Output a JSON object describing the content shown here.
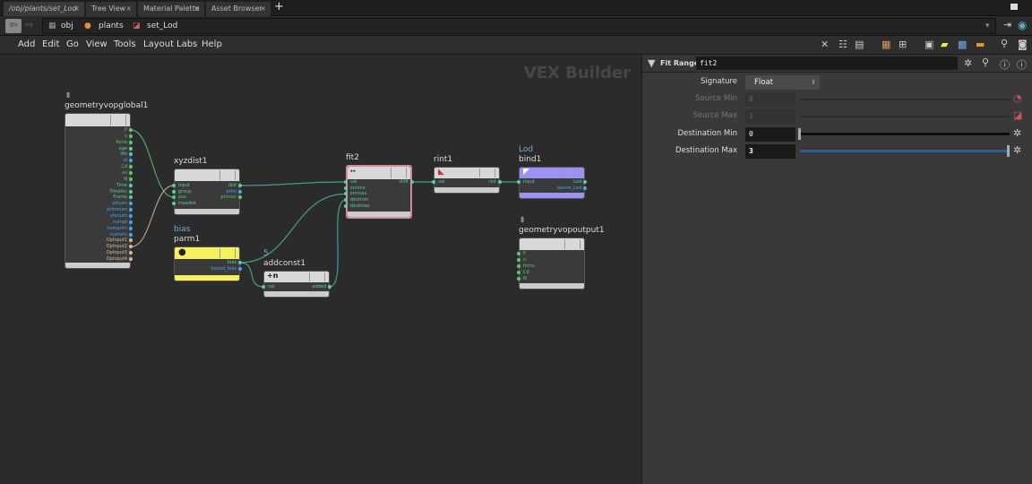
{
  "tabs": [
    {
      "label": "/obj/plants/set_Lod",
      "active": true
    },
    {
      "label": "Tree View"
    },
    {
      "label": "Material Palette"
    },
    {
      "label": "Asset Browser"
    }
  ],
  "tab_add": "+",
  "tab_close": "×",
  "breadcrumb": [
    "obj",
    "plants",
    "set_Lod"
  ],
  "menu": [
    "Add",
    "Edit",
    "Go",
    "View",
    "Tools",
    "Layout",
    "Labs",
    "Help"
  ],
  "graph_title": "VEX Builder",
  "nodes": {
    "global": {
      "name": "geometryvopglobal1",
      "outputs": [
        "P",
        "v",
        "force",
        "age",
        "life",
        "id",
        "Cd",
        "uv",
        "N",
        "Time",
        "TimeInc",
        "Frame",
        "ptnum",
        "primnum",
        "vtxnum",
        "numpt",
        "numprim",
        "numvtx",
        "OpInput1",
        "OpInput2",
        "OpInput3",
        "OpInput4"
      ]
    },
    "xyzdist": {
      "name": "xyzdist1",
      "inputs": [
        "input",
        "group",
        "pos",
        "maxdist"
      ],
      "outputs": [
        "dist",
        "prim",
        "primuv"
      ]
    },
    "parm": {
      "name": "parm1",
      "sub": "bias",
      "outputs": [
        "bias",
        "bound_bias"
      ]
    },
    "addconst": {
      "name": "addconst1",
      "sub": "5",
      "icon": "+n",
      "inputs": [
        "val"
      ],
      "outputs": [
        "added"
      ]
    },
    "fit": {
      "name": "fit2",
      "inputs": [
        "val",
        "srcmin",
        "srcmax",
        "destmin",
        "destmax"
      ],
      "outputs": [
        "shift"
      ]
    },
    "rint": {
      "name": "rint1",
      "inputs": [
        "val"
      ],
      "outputs": [
        "rint"
      ]
    },
    "bind": {
      "name": "bind1",
      "sub": "Lod",
      "inputs": [
        "input"
      ],
      "outputs": [
        "Lod",
        "bound_Lod"
      ]
    },
    "output": {
      "name": "geometryvopoutput1",
      "inputs": [
        "P",
        "v",
        "force",
        "Cd",
        "N"
      ]
    }
  },
  "params": {
    "node_type": "Fit Range",
    "node_name": "fit2",
    "signature": {
      "label": "Signature",
      "value": "Float"
    },
    "source_min": {
      "label": "Source Min",
      "value": "0"
    },
    "source_max": {
      "label": "Source Max",
      "value": "1"
    },
    "dest_min": {
      "label": "Destination Min",
      "value": "0",
      "fraction": 0
    },
    "dest_max": {
      "label": "Destination Max",
      "value": "3",
      "fraction": 1
    }
  },
  "colors": {
    "wire": "#4fb8a8",
    "float": "#5fc8b0",
    "int": "#40a8f0",
    "vec": "#5cc870",
    "str": "#d8b898",
    "parm": "#f4f060",
    "bind": "#9a92f4",
    "selected": "#d08a98"
  }
}
